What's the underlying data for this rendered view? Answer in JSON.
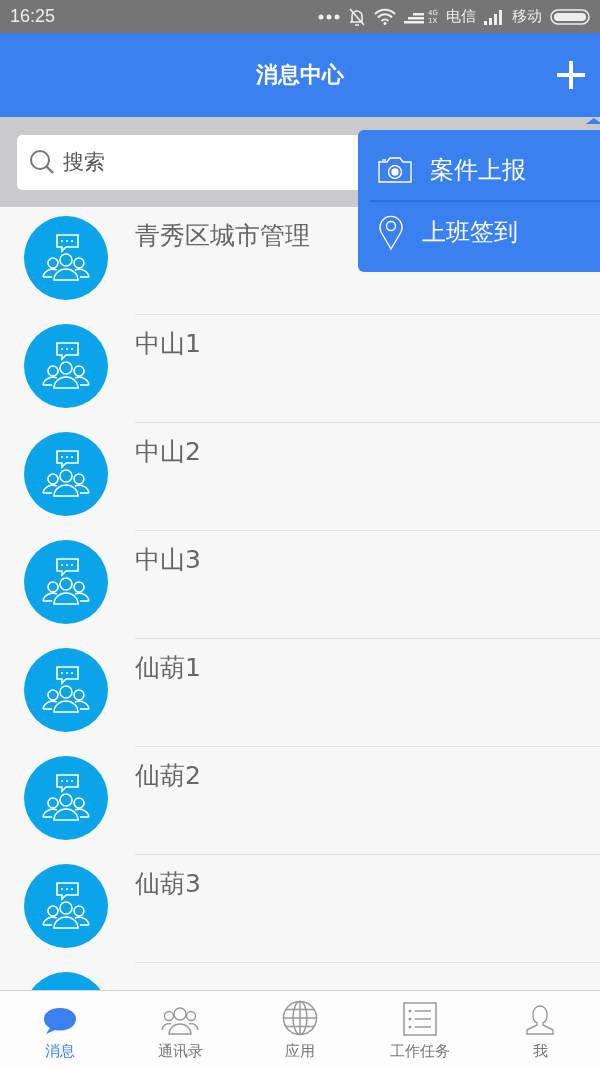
{
  "status_bar": {
    "time": "16:25",
    "network_top": "4G",
    "network_bottom": "1X",
    "carrier_1": "电信",
    "carrier_2": "移动"
  },
  "header": {
    "title": "消息中心"
  },
  "search": {
    "placeholder": "搜索"
  },
  "popup_menu": [
    {
      "label": "案件上报",
      "kind": "camera"
    },
    {
      "label": "上班签到",
      "kind": "location"
    }
  ],
  "conversations": [
    {
      "name": "青秀区城市管理",
      "kind": "group"
    },
    {
      "name": "中山1",
      "kind": "group"
    },
    {
      "name": "中山2",
      "kind": "group"
    },
    {
      "name": "中山3",
      "kind": "group"
    },
    {
      "name": "仙葫1",
      "kind": "group"
    },
    {
      "name": "仙葫2",
      "kind": "group"
    },
    {
      "name": "仙葫3",
      "kind": "group"
    },
    {
      "kind": "group"
    }
  ],
  "tabs": [
    {
      "label": "消息",
      "kind": "chat",
      "selected": true
    },
    {
      "label": "通讯录",
      "kind": "contacts",
      "selected": false
    },
    {
      "label": "应用",
      "kind": "globe",
      "selected": false
    },
    {
      "label": "工作任务",
      "kind": "list",
      "selected": false
    },
    {
      "label": "我",
      "kind": "person",
      "selected": false
    }
  ]
}
